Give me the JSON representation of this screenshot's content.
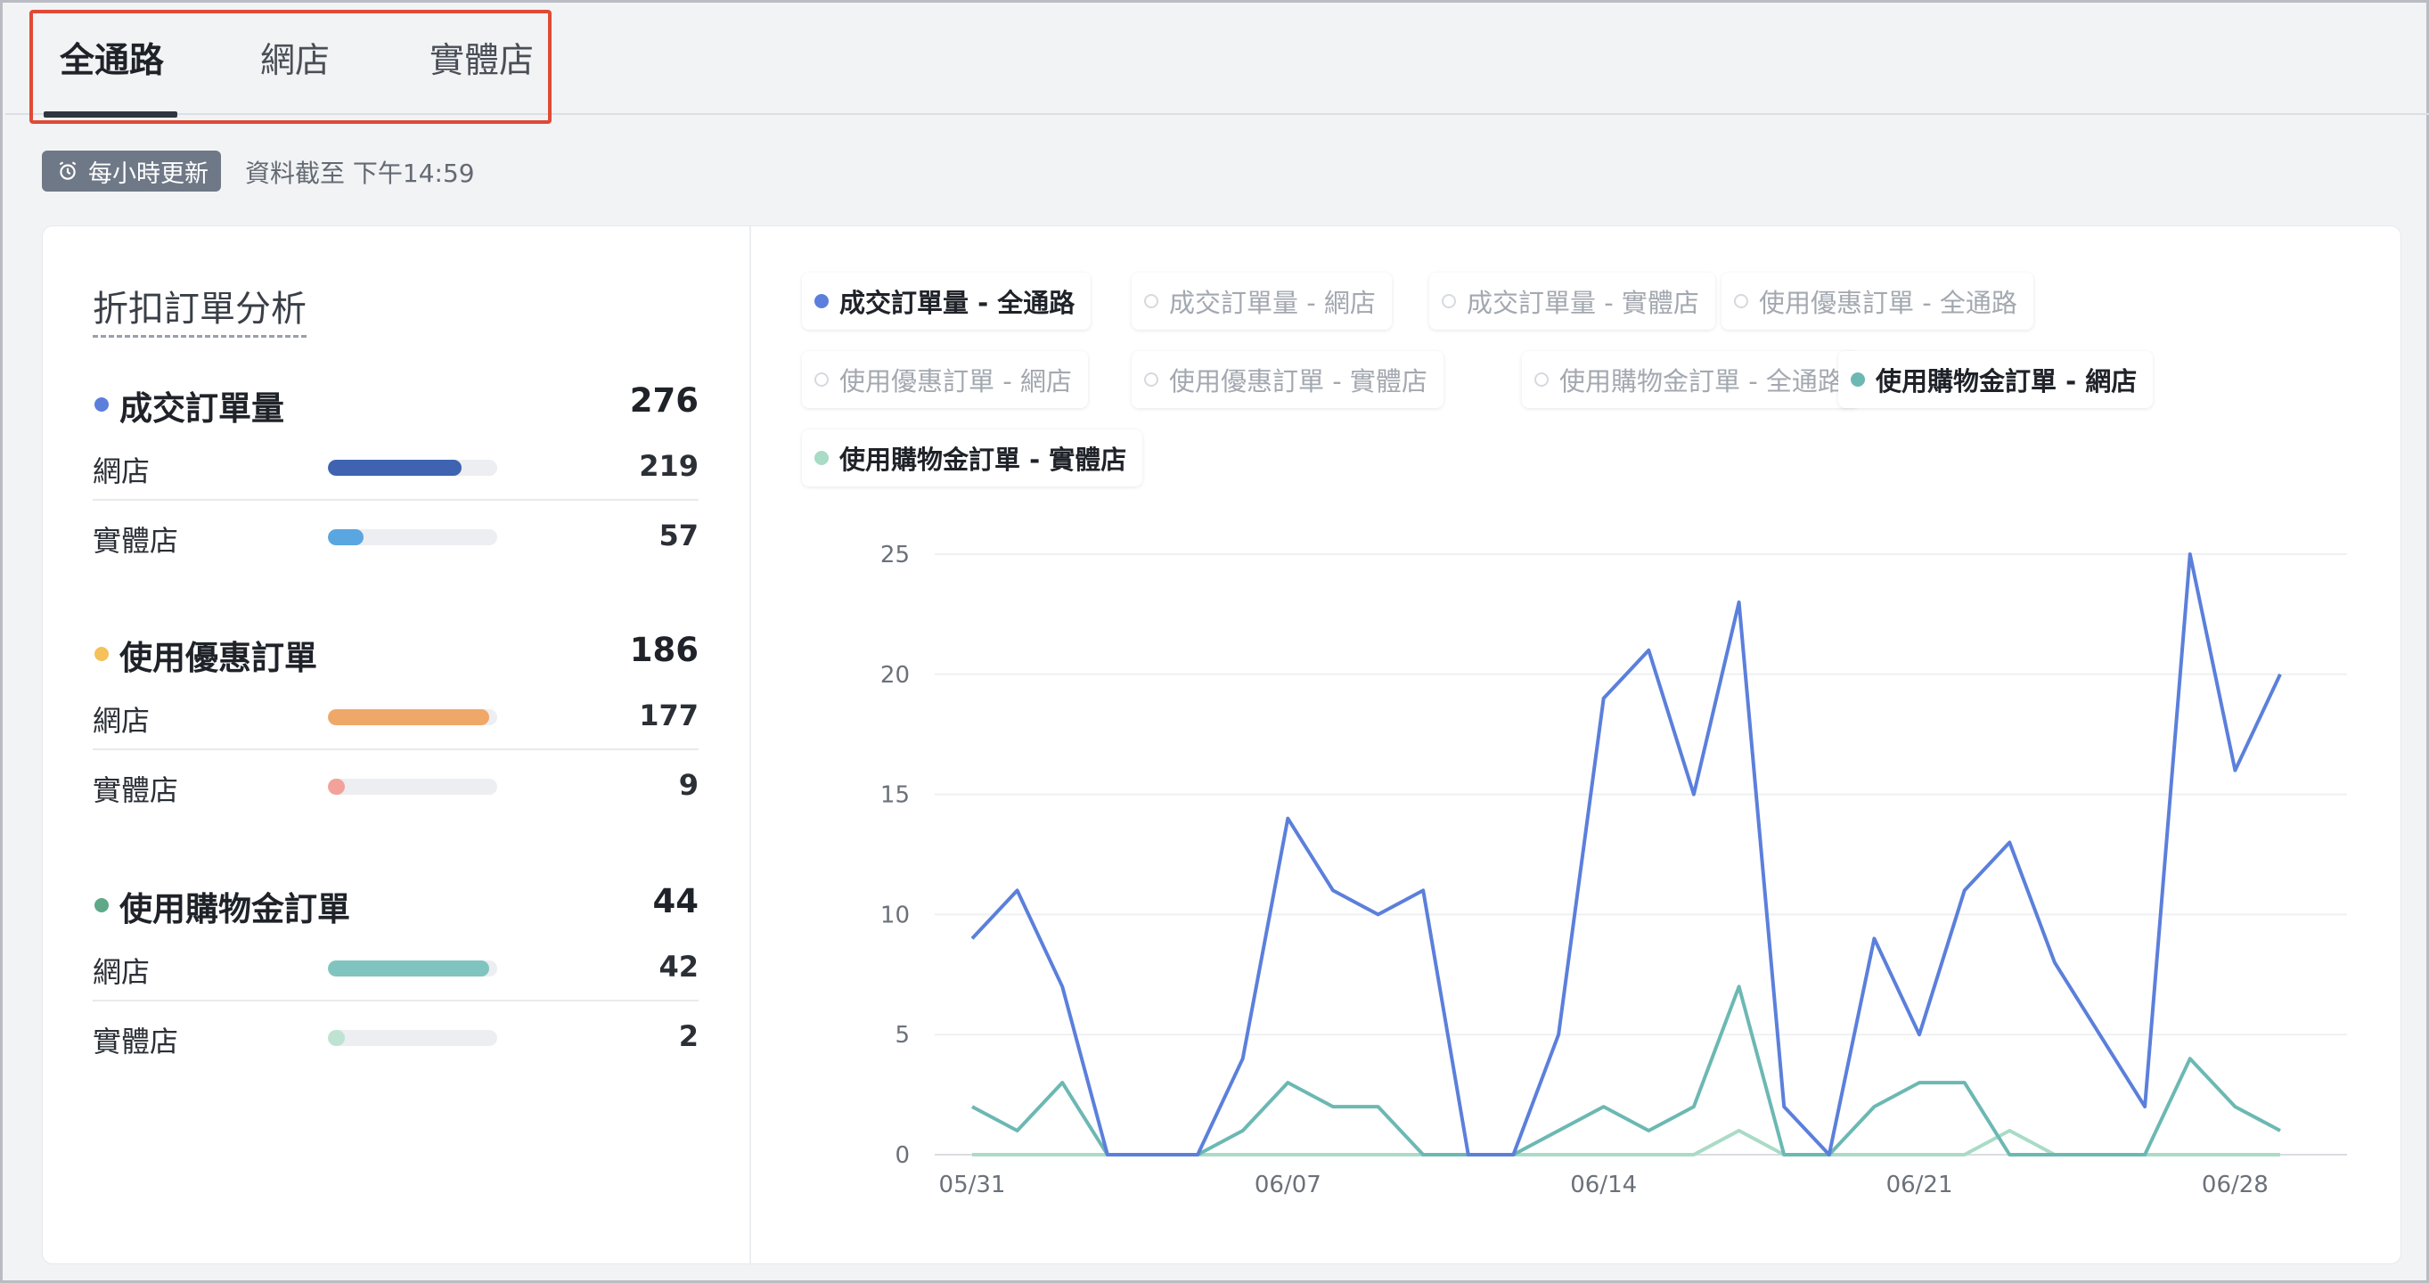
{
  "tabs": [
    {
      "label": "全通路",
      "active": true
    },
    {
      "label": "網店",
      "active": false
    },
    {
      "label": "實體店",
      "active": false
    }
  ],
  "update_badge": {
    "label": "每小時更新",
    "icon": "alarm-clock-icon"
  },
  "data_asof": "資料截至 下午14:59",
  "panel": {
    "title": "折扣訂單分析",
    "groups": [
      {
        "name": "成交訂單量",
        "total": "276",
        "color": "#5b7fdb",
        "rows": [
          {
            "label": "網店",
            "value": "219",
            "share": 0.79,
            "color": "#3f63b0"
          },
          {
            "label": "實體店",
            "value": "57",
            "share": 0.21,
            "color": "#5aa6e0"
          }
        ]
      },
      {
        "name": "使用優惠訂單",
        "total": "186",
        "color": "#f5c15a",
        "rows": [
          {
            "label": "網店",
            "value": "177",
            "share": 0.95,
            "color": "#f0a868"
          },
          {
            "label": "實體店",
            "value": "9",
            "share": 0.05,
            "color": "#f2a29a"
          }
        ]
      },
      {
        "name": "使用購物金訂單",
        "total": "44",
        "color": "#5fa888",
        "rows": [
          {
            "label": "網店",
            "value": "42",
            "share": 0.95,
            "color": "#80c4c0"
          },
          {
            "label": "實體店",
            "value": "2",
            "share": 0.05,
            "color": "#bfe3d2"
          }
        ]
      }
    ]
  },
  "legend": [
    {
      "label": "成交訂單量 - 全通路",
      "on": true,
      "color": "#5b7fdb"
    },
    {
      "label": "成交訂單量 - 網店",
      "on": false
    },
    {
      "label": "成交訂單量 - 實體店",
      "on": false
    },
    {
      "label": "使用優惠訂單 - 全通路",
      "on": false
    },
    {
      "label": "使用優惠訂單 - 網店",
      "on": false
    },
    {
      "label": "使用優惠訂單 - 實體店",
      "on": false
    },
    {
      "label": "使用購物金訂單 - 全通路",
      "on": false
    },
    {
      "label": "使用購物金訂單 - 網店",
      "on": true,
      "color": "#6cb8b3"
    },
    {
      "label": "使用購物金訂單 - 實體店",
      "on": true,
      "color": "#a9dbc6"
    }
  ],
  "chart_data": {
    "type": "line",
    "x": [
      "05/31",
      "06/01",
      "06/02",
      "06/03",
      "06/04",
      "06/05",
      "06/06",
      "06/07",
      "06/08",
      "06/09",
      "06/10",
      "06/11",
      "06/12",
      "06/13",
      "06/14",
      "06/15",
      "06/16",
      "06/17",
      "06/18",
      "06/19",
      "06/20",
      "06/21",
      "06/22",
      "06/23",
      "06/24",
      "06/25",
      "06/26",
      "06/27",
      "06/28",
      "06/29"
    ],
    "x_tick_labels": [
      "05/31",
      "06/07",
      "06/14",
      "06/21",
      "06/28"
    ],
    "ylim": [
      0,
      25
    ],
    "y_ticks": [
      0,
      5,
      10,
      15,
      20,
      25
    ],
    "grid": true,
    "series": [
      {
        "name": "成交訂單量 - 全通路",
        "color": "#5b7fdb",
        "values": [
          9,
          11,
          7,
          0,
          0,
          0,
          4,
          14,
          11,
          10,
          11,
          0,
          0,
          5,
          19,
          21,
          15,
          23,
          2,
          0,
          9,
          5,
          11,
          13,
          8,
          5,
          2,
          25,
          16,
          20
        ]
      },
      {
        "name": "使用購物金訂單 - 網店",
        "color": "#6cb8b3",
        "values": [
          2,
          1,
          3,
          0,
          0,
          0,
          1,
          3,
          2,
          2,
          0,
          0,
          0,
          1,
          2,
          1,
          2,
          7,
          0,
          0,
          2,
          3,
          3,
          0,
          0,
          0,
          0,
          4,
          2,
          1
        ]
      },
      {
        "name": "使用購物金訂單 - 實體店",
        "color": "#a9dbc6",
        "values": [
          0,
          0,
          0,
          0,
          0,
          0,
          0,
          0,
          0,
          0,
          0,
          0,
          0,
          0,
          0,
          0,
          0,
          1,
          0,
          0,
          0,
          0,
          0,
          1,
          0,
          0,
          0,
          0,
          0,
          0
        ]
      }
    ]
  }
}
